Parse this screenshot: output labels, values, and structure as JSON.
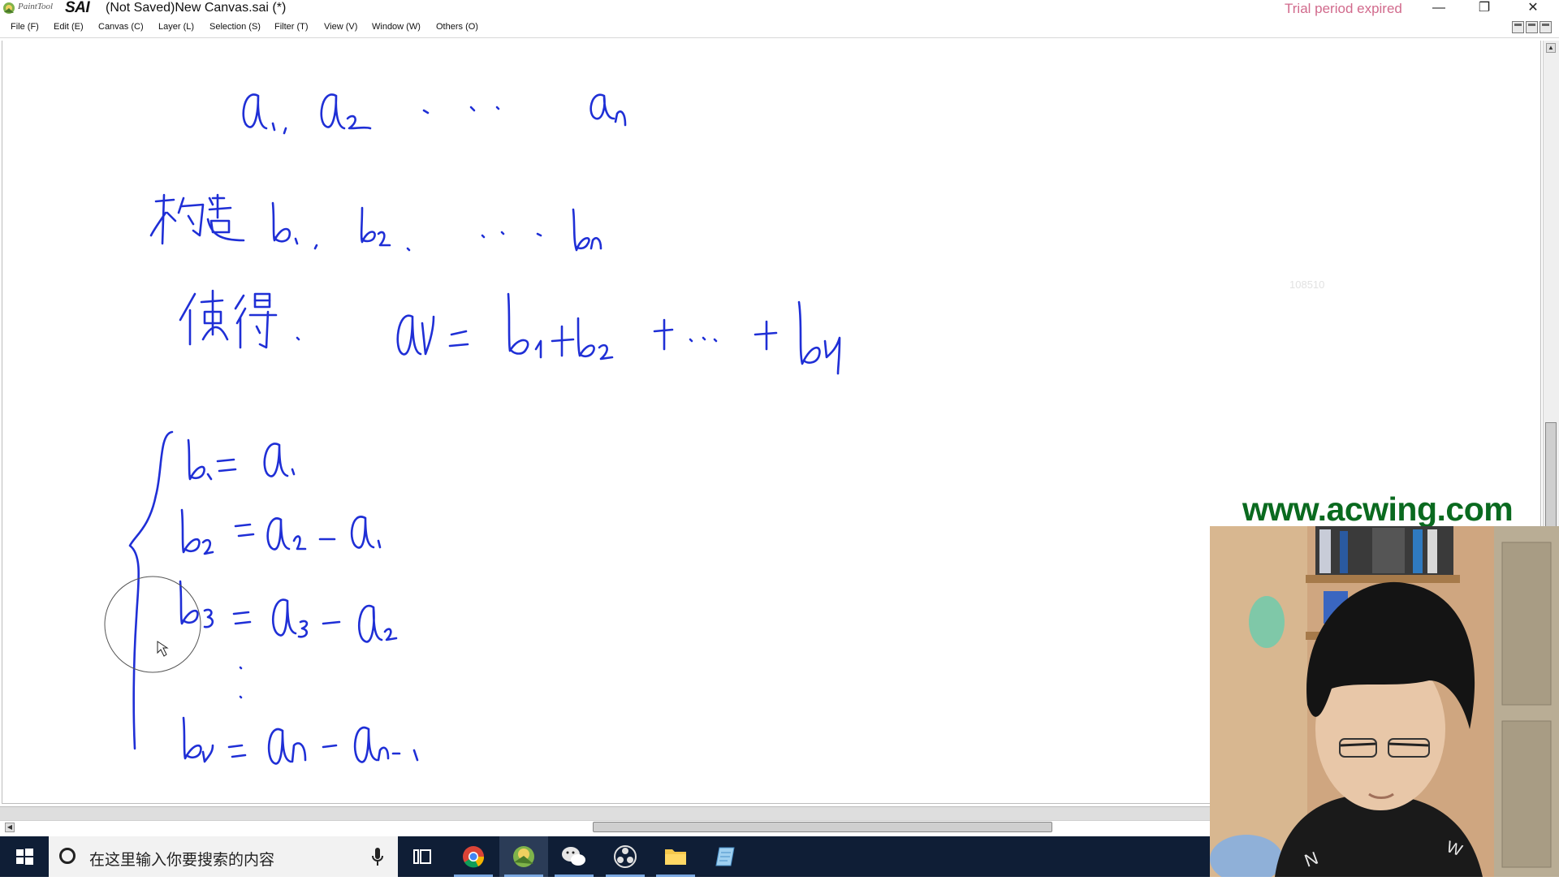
{
  "window": {
    "brand_small": "PaintTool",
    "brand_big": "SAI",
    "title": "(Not Saved)New Canvas.sai (*)",
    "trial_notice": "Trial period expired",
    "controls": {
      "minimize": "—",
      "restore": "❐",
      "close": "✕"
    }
  },
  "menu": {
    "items": [
      {
        "label": "File (F)"
      },
      {
        "label": "Edit (E)"
      },
      {
        "label": "Canvas (C)"
      },
      {
        "label": "Layer (L)"
      },
      {
        "label": "Selection (S)"
      },
      {
        "label": "Filter (T)"
      },
      {
        "label": "View (V)"
      },
      {
        "label": "Window (W)"
      },
      {
        "label": "Others (O)"
      }
    ]
  },
  "canvas": {
    "faint_number": "108510",
    "handwriting": {
      "line1": "a₁, a₂ … aₙ",
      "line2": "构造 b₁, b₂, … bₙ",
      "line3": "使得 aₙ = b₁ + b₂ + … + bₙ",
      "line4": "b₁ = a₁",
      "line5": "b₂ = a₂ − a₁",
      "line6": "b₃ = a₃ − a₂",
      "line7": "bₙ = aₙ − aₙ₋₁"
    },
    "ink_color": "#1f2fd6"
  },
  "overlay": {
    "watermark": "www.acwing.com"
  },
  "taskbar": {
    "search_placeholder": "在这里输入你要搜索的内容",
    "apps": [
      "task-view",
      "chrome",
      "paint-tool-sai",
      "wechat",
      "obs-studio",
      "file-explorer",
      "notepad"
    ]
  }
}
